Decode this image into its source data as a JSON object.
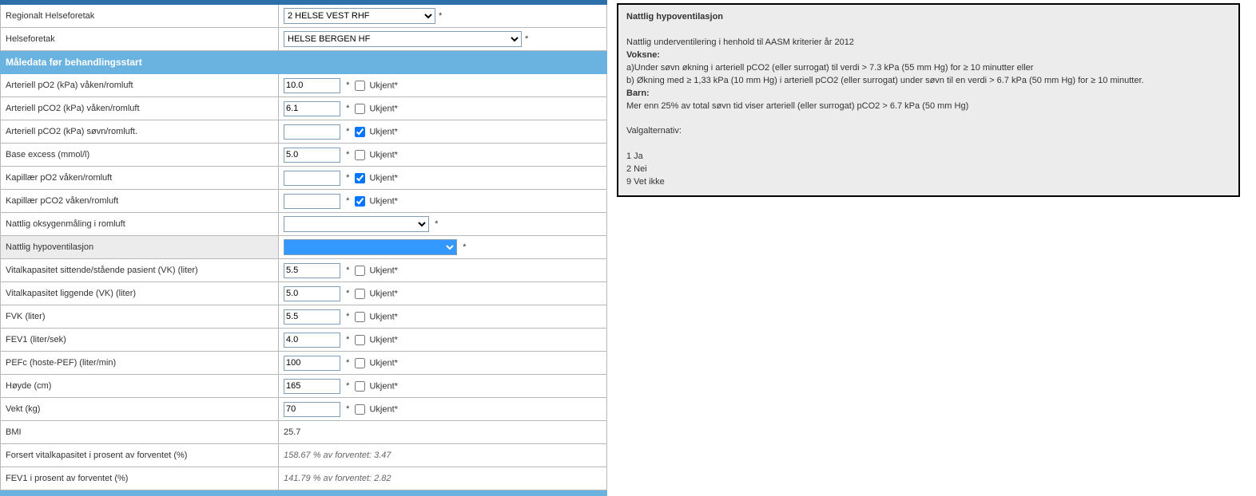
{
  "top": {
    "regionalt_label": "Regionalt Helseforetak",
    "regionalt_value": "2 HELSE VEST RHF",
    "helseforetak_label": "Helseforetak",
    "helseforetak_value": "HELSE BERGEN HF"
  },
  "section_header": "Måledata før behandlingsstart",
  "ukjent_label": "Ukjent*",
  "rows": {
    "po2": {
      "label": "Arteriell pO2 (kPa) våken/romluft",
      "value": "10.0",
      "checked": false
    },
    "pco2_vaken": {
      "label": "Arteriell pCO2 (kPa) våken/romluft",
      "value": "6.1",
      "checked": false
    },
    "pco2_sovn": {
      "label": "Arteriell pCO2 (kPa) søvn/romluft.",
      "value": "",
      "checked": true
    },
    "be": {
      "label": "Base excess (mmol/l)",
      "value": "5.0",
      "checked": false
    },
    "kap_po2": {
      "label": "Kapillær pO2 våken/romluft",
      "value": "",
      "checked": true
    },
    "kap_pco2": {
      "label": "Kapillær pCO2 våken/romluft",
      "value": "",
      "checked": true
    },
    "nat_oksy": {
      "label": "Nattlig oksygenmåling i romluft",
      "value": ""
    },
    "nat_hypo": {
      "label": "Nattlig hypoventilasjon",
      "value": ""
    },
    "vk_sitt": {
      "label": "Vitalkapasitet sittende/stående pasient (VK) (liter)",
      "value": "5.5",
      "checked": false
    },
    "vk_ligg": {
      "label": "Vitalkapasitet liggende (VK) (liter)",
      "value": "5.0",
      "checked": false
    },
    "fvk": {
      "label": "FVK (liter)",
      "value": "5.5",
      "checked": false
    },
    "fev1": {
      "label": "FEV1 (liter/sek)",
      "value": "4.0",
      "checked": false
    },
    "pefc": {
      "label": "PEFc (hoste-PEF) (liter/min)",
      "value": "100",
      "checked": false
    },
    "hoyde": {
      "label": "Høyde (cm)",
      "value": "165",
      "checked": false
    },
    "vekt": {
      "label": "Vekt (kg)",
      "value": "70",
      "checked": false
    },
    "bmi": {
      "label": "BMI",
      "value": "25.7"
    },
    "fvk_pct": {
      "label": "Forsert vitalkapasitet i prosent av forventet (%)",
      "value": "158.67 % av forventet: 3.47"
    },
    "fev1_pct": {
      "label": "FEV1 i prosent av forventet (%)",
      "value": "141.79 % av forventet: 2.82"
    }
  },
  "help": {
    "title": "Nattlig hypoventilasjon",
    "intro": "Nattlig underventilering i henhold til AASM kriterier år 2012",
    "voksne_h": "Voksne:",
    "voksne_a": "a)Under søvn økning i arteriell pCO2 (eller surrogat) til verdi > 7.3 kPa (55 mm Hg) for ≥ 10 minutter eller",
    "voksne_b": "b) Økning med ≥ 1,33 kPa (10 mm Hg) i arteriell pCO2 (eller surrogat) under søvn til en verdi > 6.7 kPa (50 mm Hg) for ≥ 10 minutter.",
    "barn_h": "Barn:",
    "barn_txt": "Mer enn 25% av total søvn tid viser arteriell (eller surrogat) pCO2 > 6.7 kPa (50 mm Hg)",
    "valgalt": "Valgalternativ:",
    "opt1": "1 Ja",
    "opt2": "2 Nei",
    "opt9": "9 Vet ikke"
  }
}
